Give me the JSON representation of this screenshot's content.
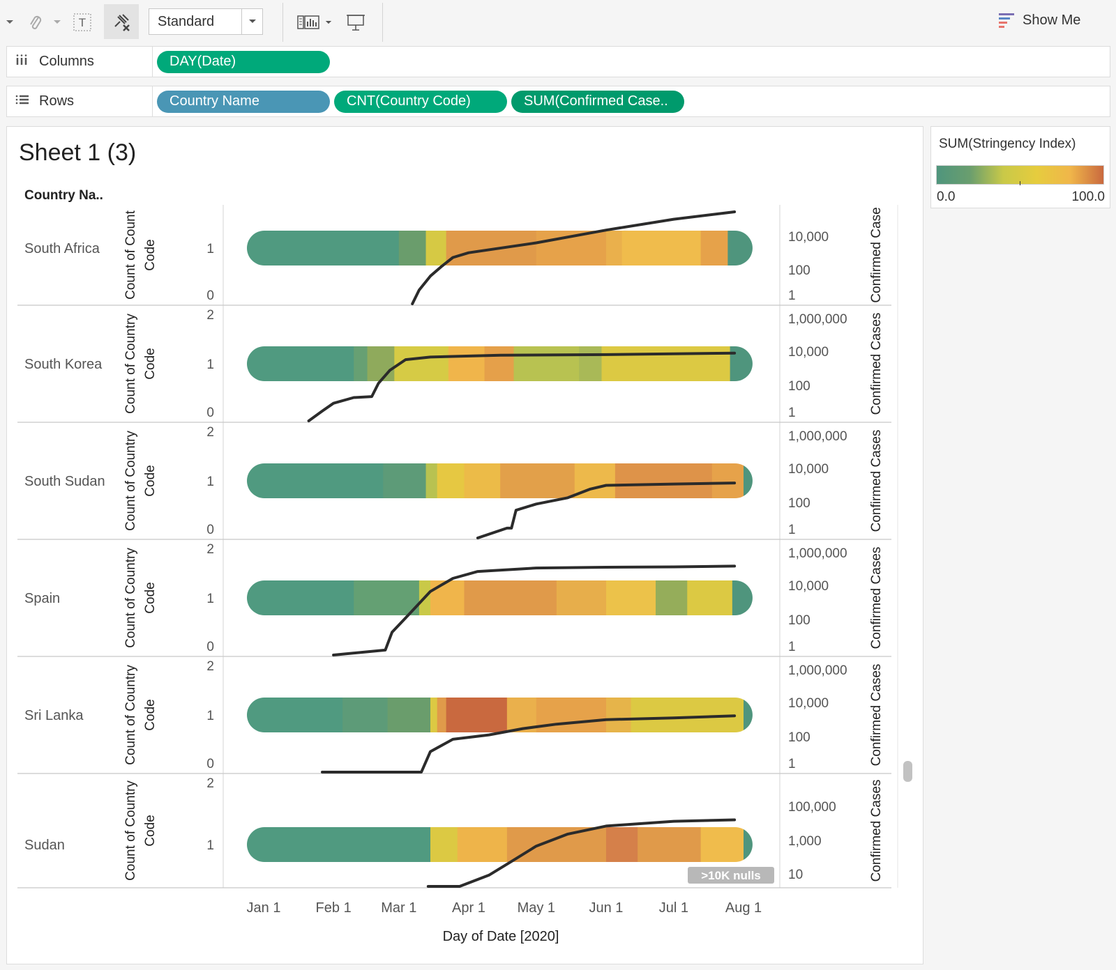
{
  "toolbar": {
    "format_select": "Standard",
    "show_me_label": "Show Me"
  },
  "shelves": {
    "columns_label": "Columns",
    "rows_label": "Rows",
    "columns_pills": [
      "DAY(Date)"
    ],
    "rows_pills": [
      "Country Name",
      "CNT(Country Code)",
      "SUM(Confirmed Case.."
    ]
  },
  "sheet": {
    "title": "Sheet 1 (3)",
    "row_header": "Country Na.."
  },
  "legend": {
    "title": "SUM(Stringency Index)",
    "min_label": "0.0",
    "max_label": "100.0",
    "colors": [
      "#4f957d",
      "#6a9e6e",
      "#c9c948",
      "#e6cc3e",
      "#f0b64a",
      "#c9693f"
    ]
  },
  "chart_data": {
    "type": "line",
    "xlabel": "Day of Date [2020]",
    "x_ticks": [
      "Jan 1",
      "Feb 1",
      "Mar 1",
      "Apr 1",
      "May 1",
      "Jun 1",
      "Jul 1",
      "Aug 1"
    ],
    "nulls_badge": ">10K nulls",
    "left_axis_label_south_africa": "Count of Count Code",
    "left_axis_label": "Count of Country Code",
    "right_axis_label_south_africa": "Confirmed Case",
    "right_axis_label": "Confirmed Cases",
    "rows": [
      {
        "country": "South Africa",
        "left_ticks": [
          "1",
          "0"
        ],
        "right_ticks": [
          "10,000",
          "100",
          "1"
        ],
        "count": 1,
        "stringency_bands": [
          {
            "start": "2020-01-01",
            "end": "2020-03-01",
            "color": "#509a80"
          },
          {
            "start": "2020-03-01",
            "end": "2020-03-13",
            "color": "#6a9d6c"
          },
          {
            "start": "2020-03-13",
            "end": "2020-03-22",
            "color": "#d6c944"
          },
          {
            "start": "2020-03-22",
            "end": "2020-05-01",
            "color": "#e09a4a"
          },
          {
            "start": "2020-05-01",
            "end": "2020-06-01",
            "color": "#e6a24a"
          },
          {
            "start": "2020-06-01",
            "end": "2020-06-08",
            "color": "#eab04c"
          },
          {
            "start": "2020-06-08",
            "end": "2020-07-13",
            "color": "#f0bc4c"
          },
          {
            "start": "2020-07-13",
            "end": "2020-07-25",
            "color": "#e6a24a"
          },
          {
            "start": "2020-07-25",
            "end": "2020-08-05",
            "color": "#4f957d"
          }
        ],
        "cases": [
          [
            "2020-03-07",
            1
          ],
          [
            "2020-03-10",
            7
          ],
          [
            "2020-03-15",
            51
          ],
          [
            "2020-03-20",
            202
          ],
          [
            "2020-03-25",
            709
          ],
          [
            "2020-04-01",
            1380
          ],
          [
            "2020-05-01",
            5647
          ],
          [
            "2020-06-01",
            34357
          ],
          [
            "2020-07-01",
            159333
          ],
          [
            "2020-07-28",
            452529
          ]
        ]
      },
      {
        "country": "South Korea",
        "left_ticks": [
          "2",
          "1",
          "0"
        ],
        "right_ticks": [
          "1,000,000",
          "10,000",
          "100",
          "1"
        ],
        "count": 1,
        "stringency_bands": [
          {
            "start": "2020-01-01",
            "end": "2020-02-10",
            "color": "#509a80"
          },
          {
            "start": "2020-02-10",
            "end": "2020-02-16",
            "color": "#67a073"
          },
          {
            "start": "2020-02-16",
            "end": "2020-02-28",
            "color": "#8faa5c"
          },
          {
            "start": "2020-02-28",
            "end": "2020-03-23",
            "color": "#d6cb45"
          },
          {
            "start": "2020-03-23",
            "end": "2020-04-08",
            "color": "#f0b54b"
          },
          {
            "start": "2020-04-08",
            "end": "2020-04-21",
            "color": "#e5a04a"
          },
          {
            "start": "2020-04-21",
            "end": "2020-05-20",
            "color": "#b8c251"
          },
          {
            "start": "2020-05-20",
            "end": "2020-05-30",
            "color": "#a9b957"
          },
          {
            "start": "2020-05-30",
            "end": "2020-07-26",
            "color": "#dcc943"
          },
          {
            "start": "2020-07-26",
            "end": "2020-08-05",
            "color": "#4f957d"
          }
        ],
        "cases": [
          [
            "2020-01-21",
            1
          ],
          [
            "2020-01-27",
            4
          ],
          [
            "2020-02-01",
            12
          ],
          [
            "2020-02-10",
            27
          ],
          [
            "2020-02-18",
            31
          ],
          [
            "2020-02-21",
            204
          ],
          [
            "2020-02-26",
            1261
          ],
          [
            "2020-03-04",
            5621
          ],
          [
            "2020-03-15",
            8162
          ],
          [
            "2020-04-15",
            10591
          ],
          [
            "2020-06-01",
            11503
          ],
          [
            "2020-07-28",
            14269
          ]
        ]
      },
      {
        "country": "South Sudan",
        "left_ticks": [
          "2",
          "1",
          "0"
        ],
        "right_ticks": [
          "1,000,000",
          "10,000",
          "100",
          "1"
        ],
        "count": 1,
        "stringency_bands": [
          {
            "start": "2020-01-01",
            "end": "2020-02-23",
            "color": "#509a80"
          },
          {
            "start": "2020-02-23",
            "end": "2020-03-13",
            "color": "#5d9b78"
          },
          {
            "start": "2020-03-13",
            "end": "2020-03-18",
            "color": "#b8c251"
          },
          {
            "start": "2020-03-18",
            "end": "2020-03-30",
            "color": "#e6c842"
          },
          {
            "start": "2020-03-30",
            "end": "2020-04-15",
            "color": "#ecbb48"
          },
          {
            "start": "2020-04-15",
            "end": "2020-05-18",
            "color": "#e2a04a"
          },
          {
            "start": "2020-05-18",
            "end": "2020-06-05",
            "color": "#edb94b"
          },
          {
            "start": "2020-06-05",
            "end": "2020-07-18",
            "color": "#de9349"
          },
          {
            "start": "2020-07-18",
            "end": "2020-08-01",
            "color": "#e6a24a"
          },
          {
            "start": "2020-08-01",
            "end": "2020-08-05",
            "color": "#4f957d"
          }
        ],
        "cases": [
          [
            "2020-04-05",
            1
          ],
          [
            "2020-04-18",
            4
          ],
          [
            "2020-04-20",
            4
          ],
          [
            "2020-04-22",
            50
          ],
          [
            "2020-05-01",
            120
          ],
          [
            "2020-05-15",
            290
          ],
          [
            "2020-05-25",
            994
          ],
          [
            "2020-06-01",
            1670
          ],
          [
            "2020-06-15",
            1830
          ],
          [
            "2020-07-01",
            2021
          ],
          [
            "2020-07-28",
            2322
          ]
        ]
      },
      {
        "country": "Spain",
        "left_ticks": [
          "2",
          "1",
          "0"
        ],
        "right_ticks": [
          "1,000,000",
          "10,000",
          "100",
          "1"
        ],
        "count": 1,
        "stringency_bands": [
          {
            "start": "2020-01-01",
            "end": "2020-02-10",
            "color": "#509a80"
          },
          {
            "start": "2020-02-10",
            "end": "2020-03-10",
            "color": "#64a073"
          },
          {
            "start": "2020-03-10",
            "end": "2020-03-15",
            "color": "#c9c948"
          },
          {
            "start": "2020-03-15",
            "end": "2020-03-30",
            "color": "#f0b54b"
          },
          {
            "start": "2020-03-30",
            "end": "2020-05-10",
            "color": "#e09a4a"
          },
          {
            "start": "2020-05-10",
            "end": "2020-06-01",
            "color": "#e7ae4b"
          },
          {
            "start": "2020-06-01",
            "end": "2020-06-23",
            "color": "#ecc24a"
          },
          {
            "start": "2020-06-23",
            "end": "2020-07-07",
            "color": "#95ad5a"
          },
          {
            "start": "2020-07-07",
            "end": "2020-07-27",
            "color": "#dcc943"
          },
          {
            "start": "2020-07-27",
            "end": "2020-08-05",
            "color": "#4f957d"
          }
        ],
        "cases": [
          [
            "2020-02-01",
            1
          ],
          [
            "2020-02-24",
            2
          ],
          [
            "2020-02-27",
            25
          ],
          [
            "2020-03-05",
            261
          ],
          [
            "2020-03-15",
            7798
          ],
          [
            "2020-03-25",
            49515
          ],
          [
            "2020-04-05",
            130759
          ],
          [
            "2020-05-01",
            215216
          ],
          [
            "2020-06-01",
            239638
          ],
          [
            "2020-07-01",
            249659
          ],
          [
            "2020-07-28",
            280610
          ]
        ]
      },
      {
        "country": "Sri Lanka",
        "left_ticks": [
          "2",
          "1",
          "0"
        ],
        "right_ticks": [
          "1,000,000",
          "10,000",
          "100",
          "1"
        ],
        "count": 1,
        "stringency_bands": [
          {
            "start": "2020-01-01",
            "end": "2020-02-05",
            "color": "#509a80"
          },
          {
            "start": "2020-02-05",
            "end": "2020-02-25",
            "color": "#5d9b78"
          },
          {
            "start": "2020-02-25",
            "end": "2020-03-15",
            "color": "#6a9d6c"
          },
          {
            "start": "2020-03-15",
            "end": "2020-03-18",
            "color": "#dcc943"
          },
          {
            "start": "2020-03-18",
            "end": "2020-03-22",
            "color": "#e09a4a"
          },
          {
            "start": "2020-03-22",
            "end": "2020-04-18",
            "color": "#c9693f"
          },
          {
            "start": "2020-04-18",
            "end": "2020-05-01",
            "color": "#eab04c"
          },
          {
            "start": "2020-05-01",
            "end": "2020-06-01",
            "color": "#e6a24a"
          },
          {
            "start": "2020-06-01",
            "end": "2020-06-12",
            "color": "#e6b44a"
          },
          {
            "start": "2020-06-12",
            "end": "2020-08-01",
            "color": "#dcc943"
          },
          {
            "start": "2020-08-01",
            "end": "2020-08-05",
            "color": "#4f957d"
          }
        ],
        "cases": [
          [
            "2020-01-27",
            1
          ],
          [
            "2020-03-11",
            1
          ],
          [
            "2020-03-15",
            18
          ],
          [
            "2020-03-25",
            102
          ],
          [
            "2020-04-10",
            190
          ],
          [
            "2020-04-25",
            460
          ],
          [
            "2020-05-10",
            863
          ],
          [
            "2020-06-01",
            1633
          ],
          [
            "2020-07-01",
            2066
          ],
          [
            "2020-07-28",
            2814
          ]
        ]
      },
      {
        "country": "Sudan",
        "left_ticks": [
          "2",
          "1"
        ],
        "right_ticks": [
          "100,000",
          "1,000",
          "10"
        ],
        "count": 1,
        "stringency_bands": [
          {
            "start": "2020-01-01",
            "end": "2020-03-15",
            "color": "#509a80"
          },
          {
            "start": "2020-03-15",
            "end": "2020-03-27",
            "color": "#dcc943"
          },
          {
            "start": "2020-03-27",
            "end": "2020-04-18",
            "color": "#eeb44a"
          },
          {
            "start": "2020-04-18",
            "end": "2020-06-01",
            "color": "#e09a4a"
          },
          {
            "start": "2020-06-01",
            "end": "2020-06-15",
            "color": "#d5804a"
          },
          {
            "start": "2020-06-15",
            "end": "2020-07-13",
            "color": "#e09a4a"
          },
          {
            "start": "2020-07-13",
            "end": "2020-08-01",
            "color": "#f0bc4c"
          },
          {
            "start": "2020-08-01",
            "end": "2020-08-05",
            "color": "#4f957d"
          }
        ],
        "cases": [
          [
            "2020-03-14",
            1
          ],
          [
            "2020-03-28",
            2
          ],
          [
            "2020-04-10",
            12
          ],
          [
            "2020-04-20",
            66
          ],
          [
            "2020-05-01",
            442
          ],
          [
            "2020-05-15",
            1964
          ],
          [
            "2020-06-01",
            5310
          ],
          [
            "2020-07-01",
            9573
          ],
          [
            "2020-07-28",
            11424
          ]
        ]
      }
    ]
  }
}
